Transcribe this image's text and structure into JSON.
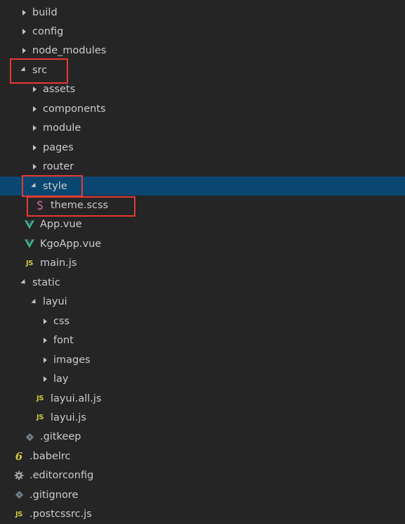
{
  "explorer": {
    "items": [
      {
        "label": "build",
        "kind": "folder",
        "state": "collapsed",
        "depth": 0
      },
      {
        "label": "config",
        "kind": "folder",
        "state": "collapsed",
        "depth": 0
      },
      {
        "label": "node_modules",
        "kind": "folder",
        "state": "collapsed",
        "depth": 0
      },
      {
        "label": "src",
        "kind": "folder",
        "state": "expanded",
        "depth": 0
      },
      {
        "label": "assets",
        "kind": "folder",
        "state": "collapsed",
        "depth": 1
      },
      {
        "label": "components",
        "kind": "folder",
        "state": "collapsed",
        "depth": 1
      },
      {
        "label": "module",
        "kind": "folder",
        "state": "collapsed",
        "depth": 1
      },
      {
        "label": "pages",
        "kind": "folder",
        "state": "collapsed",
        "depth": 1
      },
      {
        "label": "router",
        "kind": "folder",
        "state": "collapsed",
        "depth": 1
      },
      {
        "label": "style",
        "kind": "folder",
        "state": "expanded",
        "depth": 1,
        "selected": true
      },
      {
        "label": "theme.scss",
        "kind": "file",
        "icon": "sass-icon",
        "depth": 2
      },
      {
        "label": "App.vue",
        "kind": "file",
        "icon": "vue-icon",
        "depth": 1
      },
      {
        "label": "KgoApp.vue",
        "kind": "file",
        "icon": "vue-icon",
        "depth": 1
      },
      {
        "label": "main.js",
        "kind": "file",
        "icon": "js-icon",
        "depth": 1
      },
      {
        "label": "static",
        "kind": "folder",
        "state": "expanded",
        "depth": 0
      },
      {
        "label": "layui",
        "kind": "folder",
        "state": "expanded",
        "depth": 1
      },
      {
        "label": "css",
        "kind": "folder",
        "state": "collapsed",
        "depth": 2
      },
      {
        "label": "font",
        "kind": "folder",
        "state": "collapsed",
        "depth": 2
      },
      {
        "label": "images",
        "kind": "folder",
        "state": "collapsed",
        "depth": 2
      },
      {
        "label": "lay",
        "kind": "folder",
        "state": "collapsed",
        "depth": 2
      },
      {
        "label": "layui.all.js",
        "kind": "file",
        "icon": "js-icon",
        "depth": 2
      },
      {
        "label": "layui.js",
        "kind": "file",
        "icon": "js-icon",
        "depth": 2
      },
      {
        "label": ".gitkeep",
        "kind": "file",
        "icon": "git-icon",
        "depth": 1
      },
      {
        "label": ".babelrc",
        "kind": "file",
        "icon": "babel-icon",
        "depth": 0
      },
      {
        "label": ".editorconfig",
        "kind": "file",
        "icon": "gear-icon",
        "depth": 0
      },
      {
        "label": ".gitignore",
        "kind": "file",
        "icon": "git-icon",
        "depth": 0
      },
      {
        "label": ".postcssrc.js",
        "kind": "file",
        "icon": "js-icon",
        "depth": 0
      }
    ]
  },
  "icon_glyphs": {
    "js-icon": "JS",
    "babel-icon": "6"
  },
  "colors": {
    "background": "#252526",
    "selected_row": "#094771",
    "highlight_box": "#e53935",
    "vue_green": "#41b883",
    "vue_dark": "#35495e",
    "sass_pink": "#cd6799",
    "js_yellow": "#cbcb41",
    "git_gray": "#6d8086"
  }
}
